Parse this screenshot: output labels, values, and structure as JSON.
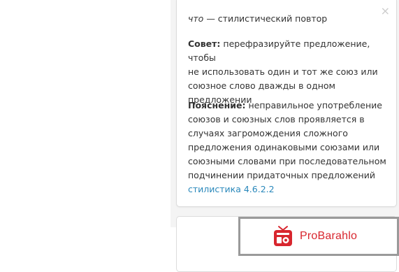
{
  "suggestion": {
    "word": "что",
    "issue_text": "— стилистический повтор",
    "close_glyph": "×",
    "advice_label": "Совет:",
    "advice_text": "перефразируйте предложение, чтобы\nне использовать один и тот же союз или\nсоюзное слово дважды в одном\nпредложении",
    "explain_label": "Пояснение:",
    "explain_text": "неправильное употребление\nсоюзов и союзных слов проявляется в\nслучаях загромождения сложного\nпредложения одинаковыми союзами или\nсоюзными словами при последовательном\nподчинении придаточных предложений",
    "reference_link": "стилистика 4.6.2.2"
  },
  "badge": {
    "text": "ProBarahlo",
    "icon": "radio-icon",
    "brand_color": "#d8262e"
  }
}
